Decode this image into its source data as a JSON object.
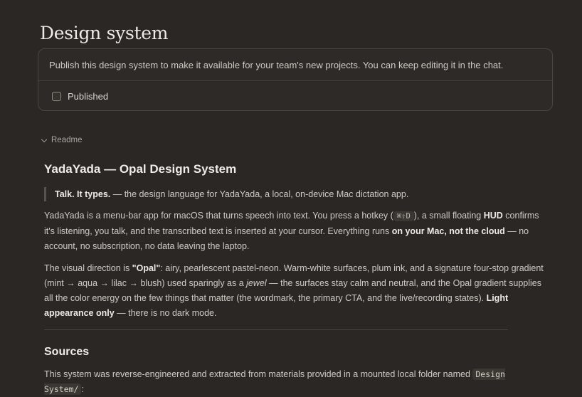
{
  "page": {
    "title": "Design system"
  },
  "publish": {
    "message": "Publish this design system to make it available for your team's new projects. You can keep editing it in the chat.",
    "checkbox_label": "Published",
    "checked": false
  },
  "readme_section": {
    "label": "Readme",
    "heading": "YadaYada — Opal Design System",
    "quote": {
      "bold": "Talk. It types.",
      "rest": " — the design language for YadaYada, a local, on-device Mac dictation app."
    },
    "para1": {
      "t1": "YadaYada is a menu-bar app for macOS that turns speech into text. You press a hotkey (",
      "hotkey": "⌘⇧D",
      "t2": "), a small floating ",
      "b1": "HUD",
      "t3": " confirms it's listening, you talk, and the transcribed text is inserted at your cursor. Everything runs ",
      "b2": "on your Mac, not the cloud",
      "t4": " — no account, no subscription, no data leaving the laptop."
    },
    "para2": {
      "t1": "The visual direction is ",
      "b1": "\"Opal\"",
      "t2": ": airy, pearlescent pastel-neon. Warm-white surfaces, plum ink, and a signature four-stop gradient (mint → aqua → lilac → blush) used sparingly as a ",
      "i1": "jewel",
      "t3": " — the surfaces stay calm and neutral, and the Opal gradient supplies all the color energy on the few things that matter (the wordmark, the primary CTA, and the live/recording states). ",
      "b2": "Light appearance only",
      "t4": " — there is no dark mode."
    },
    "sources_heading": "Sources",
    "sources_para": {
      "t1": "This system was reverse-engineered and extracted from materials provided in a mounted local folder named ",
      "code": "Design System/",
      "t2": ":"
    }
  }
}
